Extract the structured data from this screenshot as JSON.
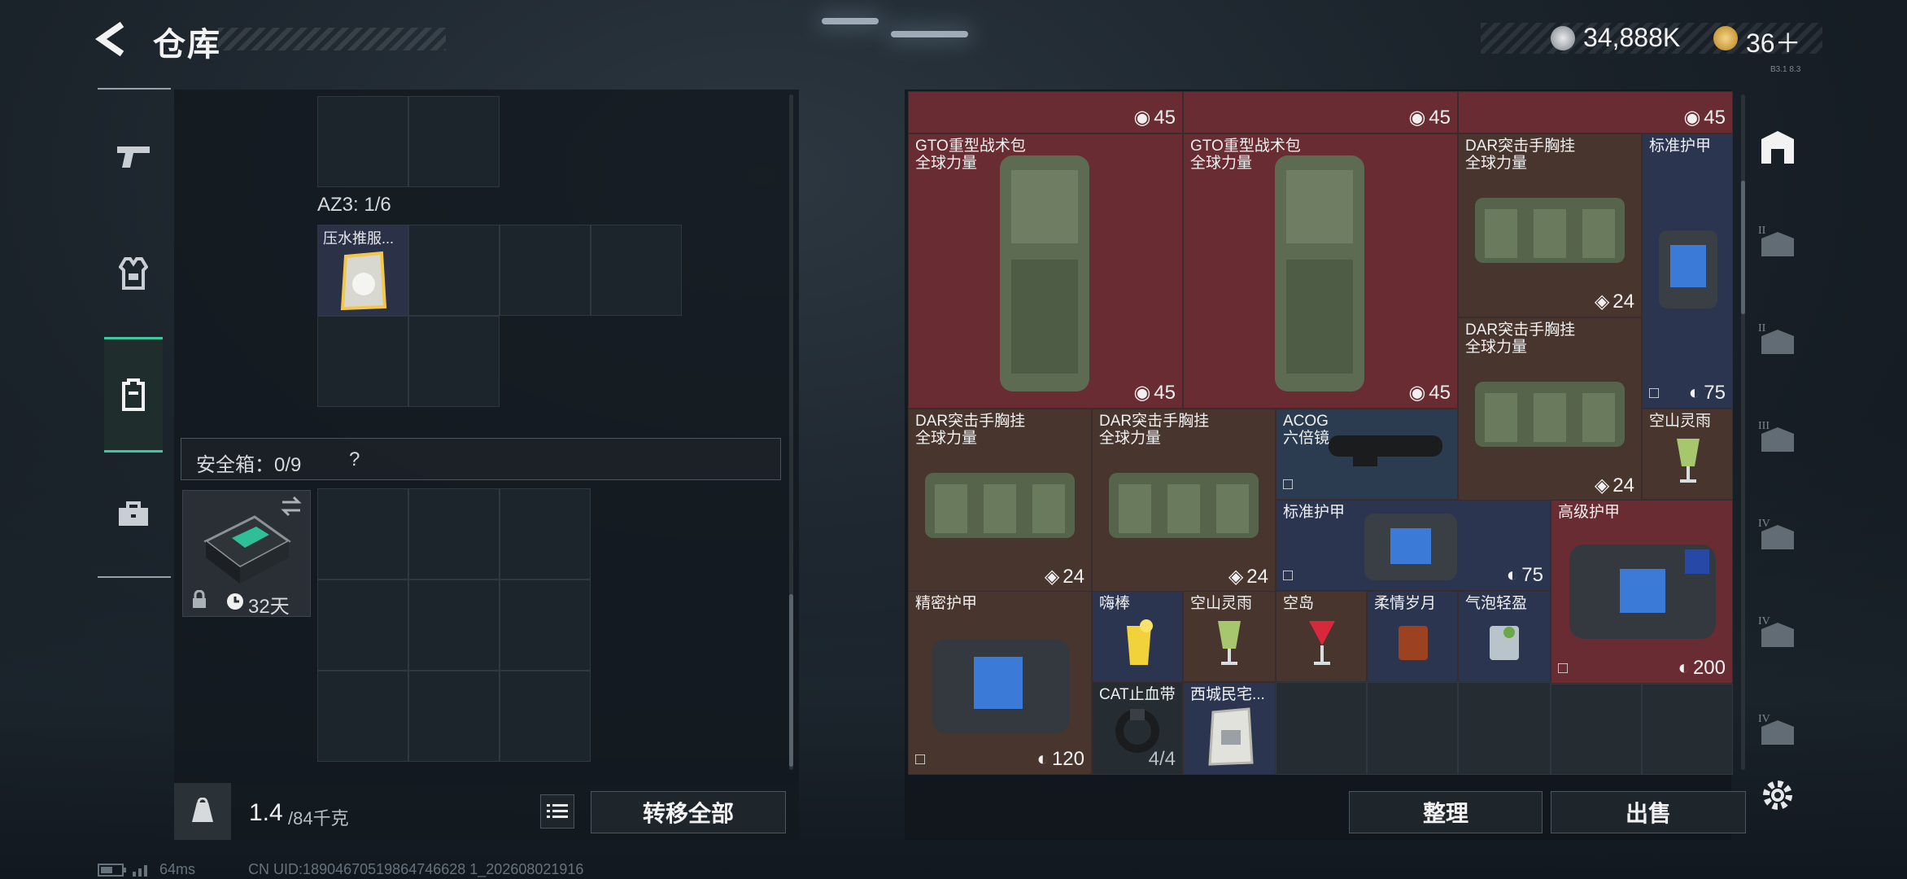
{
  "header": {
    "title": "仓库",
    "currency": "34,888K",
    "tokens": "36＋",
    "version": "B3.1 8.3"
  },
  "left": {
    "container_label": "AZ3: 1/6",
    "container_item": "压水推服...",
    "safe_label": "安全箱：0/9",
    "safe_help": "?",
    "safe_days": "32天",
    "weight": "1.4",
    "weight_cap": "/84千克",
    "transfer_all": "转移全部"
  },
  "right": {
    "items": [
      {
        "name": "",
        "sub": "",
        "count": "45"
      },
      {
        "name": "",
        "sub": "",
        "count": "45"
      },
      {
        "name": "",
        "sub": "",
        "count": "45"
      },
      {
        "name": "GTO重型战术包",
        "sub": "全球力量",
        "count": "45"
      },
      {
        "name": "GTO重型战术包",
        "sub": "全球力量",
        "count": "45"
      },
      {
        "name": "DAR突击手胸挂",
        "sub": "全球力量",
        "count": "24"
      },
      {
        "name": "标准护甲",
        "sub": "",
        "count": "75"
      },
      {
        "name": "DAR突击手胸挂",
        "sub": "全球力量",
        "count": "24"
      },
      {
        "name": "DAR突击手胸挂",
        "sub": "全球力量",
        "count": "24"
      },
      {
        "name": "DAR突击手胸挂",
        "sub": "全球力量",
        "count": "24"
      },
      {
        "name": "ACOG",
        "sub": "六倍镜",
        "count": ""
      },
      {
        "name": "空山灵雨",
        "sub": "",
        "count": ""
      },
      {
        "name": "标准护甲",
        "sub": "",
        "count": "75"
      },
      {
        "name": "高级护甲",
        "sub": "",
        "count": "200"
      },
      {
        "name": "精密护甲",
        "sub": "",
        "count": "120"
      },
      {
        "name": "嗨棒",
        "sub": "",
        "count": ""
      },
      {
        "name": "空山灵雨",
        "sub": "",
        "count": ""
      },
      {
        "name": "空岛",
        "sub": "",
        "count": ""
      },
      {
        "name": "柔情岁月",
        "sub": "",
        "count": ""
      },
      {
        "name": "气泡轻盈",
        "sub": "",
        "count": ""
      },
      {
        "name": "CAT止血带",
        "sub": "",
        "count": "4/4"
      },
      {
        "name": "西城民宅...",
        "sub": "",
        "count": ""
      }
    ],
    "sort_btn": "整理",
    "sell_btn": "出售"
  },
  "status": {
    "ping": "64ms",
    "uid": "CN UID:18904670519864746628 1_202608021916"
  },
  "colors": {
    "accent": "#3cc8a0",
    "red_cell": "#6a2c33",
    "brown_cell": "#47352e",
    "blue_cell": "#2b3550"
  }
}
